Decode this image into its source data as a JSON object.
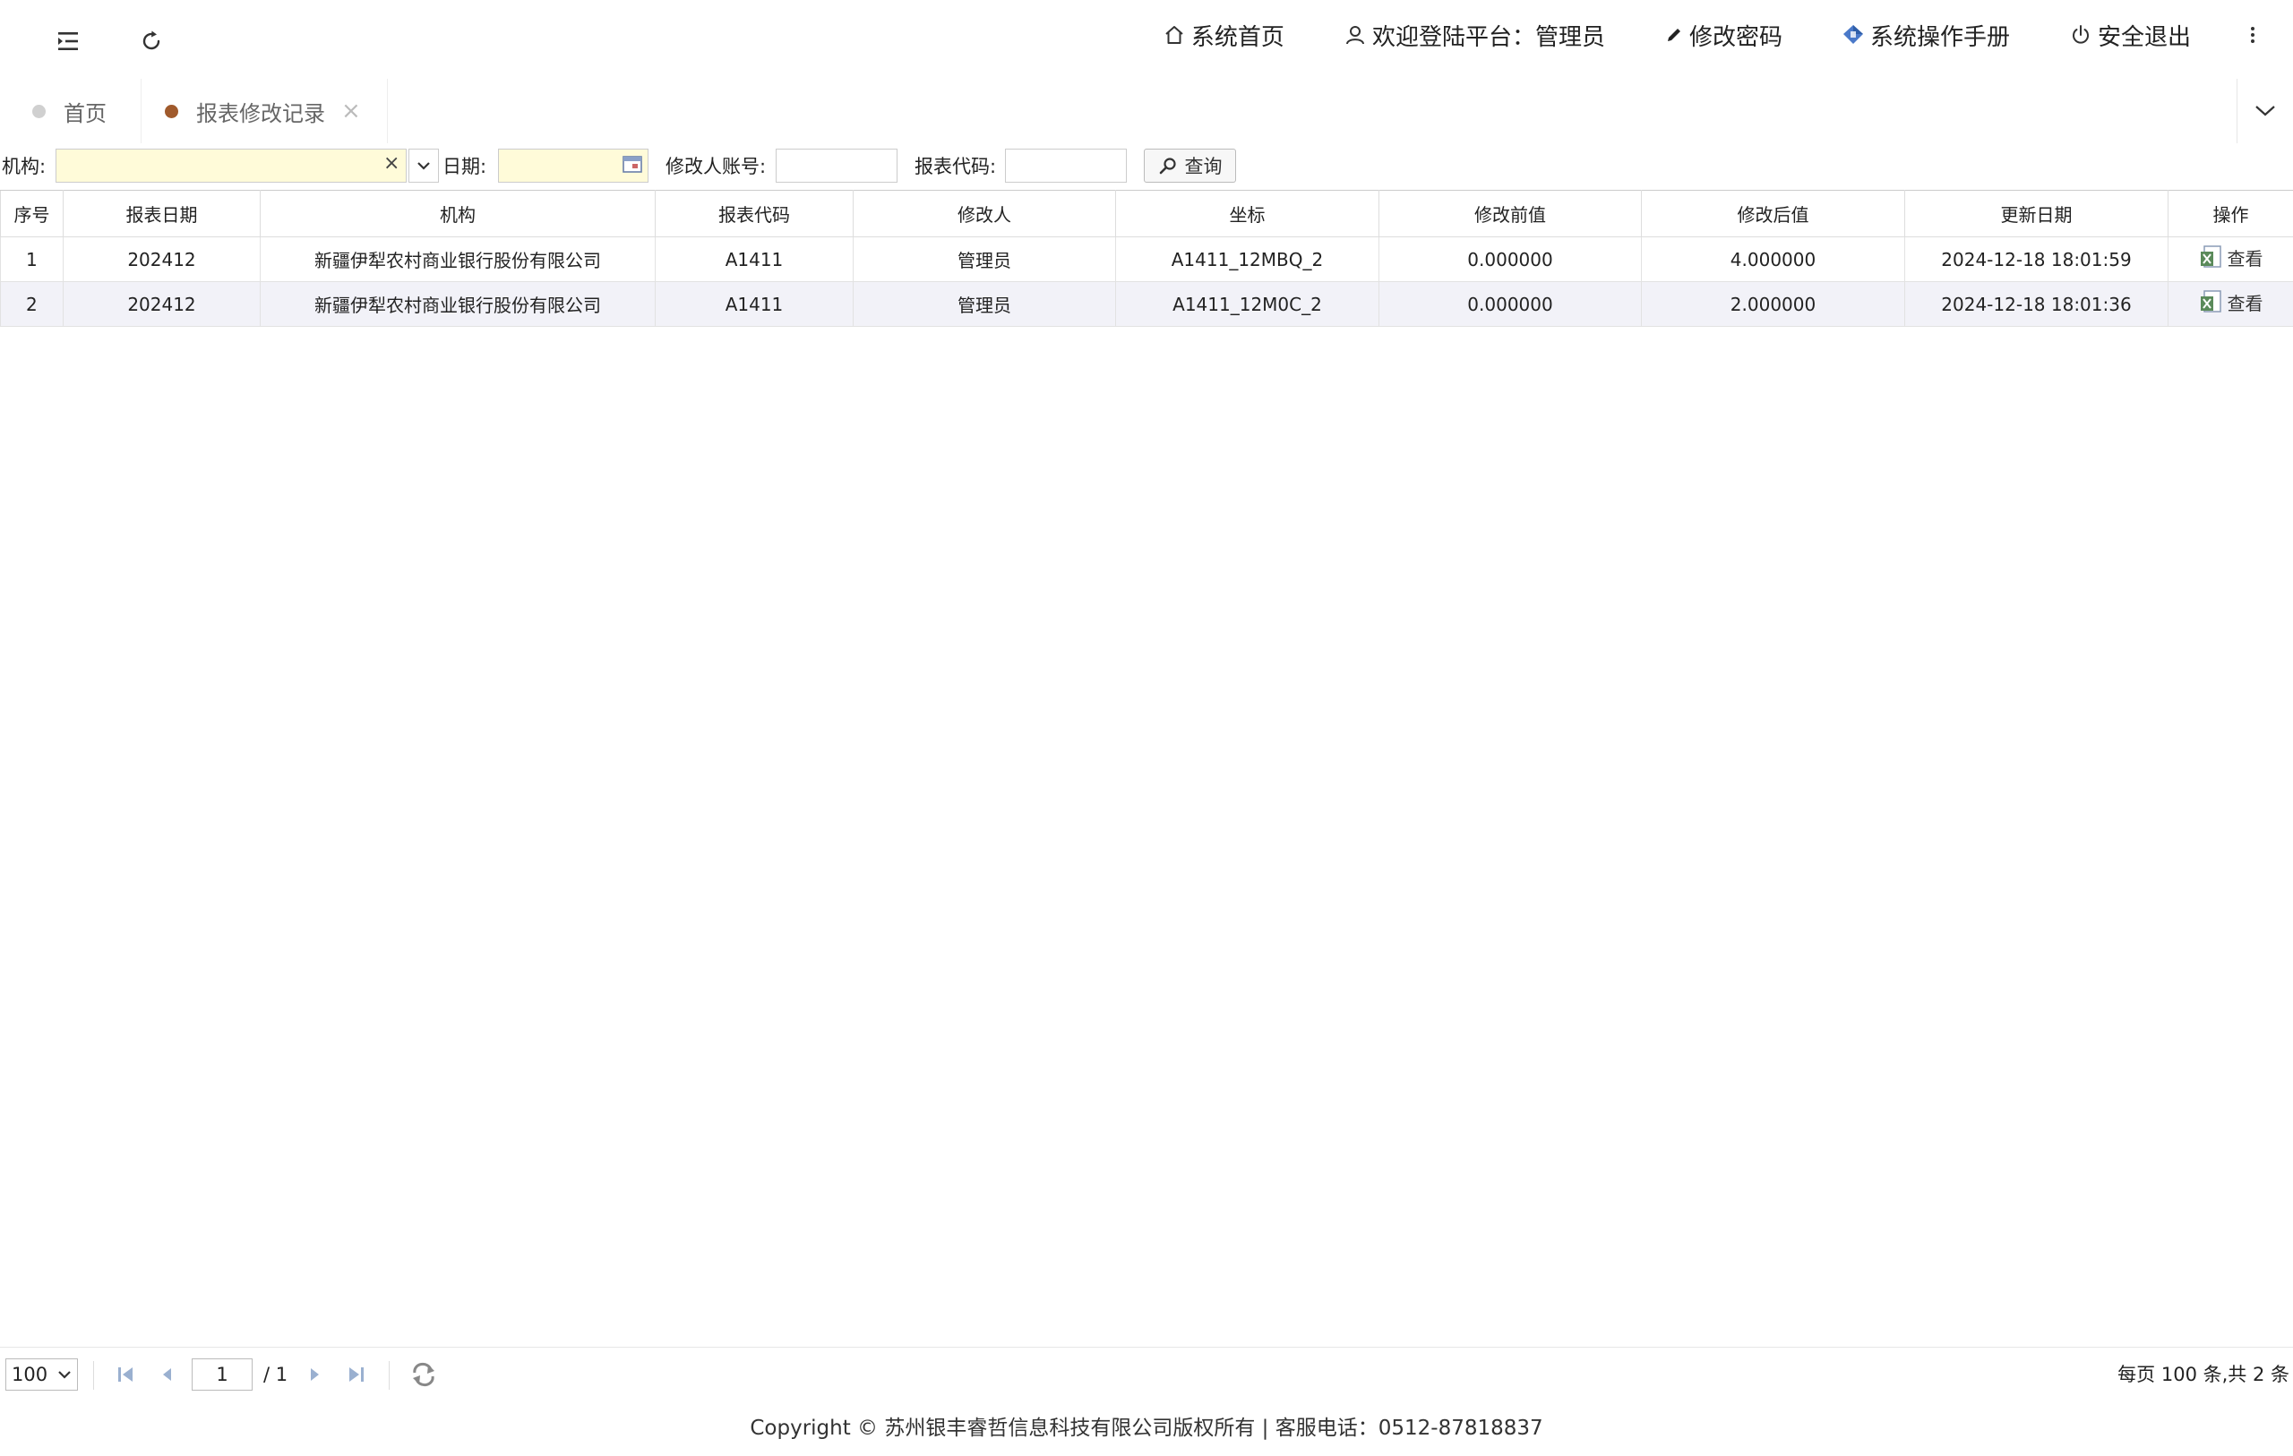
{
  "header": {
    "nav": [
      {
        "label": "系统首页",
        "icon": "home-icon"
      },
      {
        "label": "欢迎登陆平台：管理员",
        "icon": "user-icon"
      },
      {
        "label": "修改密码",
        "icon": "pencil-icon"
      },
      {
        "label": "系统操作手册",
        "icon": "manual-book-icon"
      },
      {
        "label": "安全退出",
        "icon": "power-icon"
      }
    ]
  },
  "tabs": [
    {
      "label": "首页",
      "dot_color": "#d0d0d0",
      "active": false
    },
    {
      "label": "报表修改记录",
      "dot_color": "#a05a2c",
      "active": true,
      "close": "×"
    }
  ],
  "filter": {
    "org_label": "机构:",
    "org_value": "",
    "clear_symbol": "×",
    "date_label": "日期:",
    "date_value": "",
    "modifier_label": "修改人账号:",
    "modifier_value": "",
    "code_label": "报表代码:",
    "code_value": "",
    "query_label": "查询"
  },
  "table": {
    "columns": [
      "序号",
      "报表日期",
      "机构",
      "报表代码",
      "修改人",
      "坐标",
      "修改前值",
      "修改后值",
      "更新日期",
      "操作"
    ],
    "rows": [
      {
        "idx": "1",
        "report_date": "202412",
        "org": "新疆伊犁农村商业银行股份有限公司",
        "code": "A1411",
        "modifier": "管理员",
        "coord": "A1411_12MBQ_2",
        "before": "0.000000",
        "after": "4.000000",
        "updated": "2024-12-18 18:01:59",
        "action": "查看"
      },
      {
        "idx": "2",
        "report_date": "202412",
        "org": "新疆伊犁农村商业银行股份有限公司",
        "code": "A1411",
        "modifier": "管理员",
        "coord": "A1411_12M0C_2",
        "before": "0.000000",
        "after": "2.000000",
        "updated": "2024-12-18 18:01:36",
        "action": "查看"
      }
    ]
  },
  "pager": {
    "page_size": "100",
    "current_page": "1",
    "total_pages": "/ 1",
    "summary": "每页 100 条,共 2 条"
  },
  "footer": {
    "text": "Copyright © 苏州银丰睿哲信息科技有限公司版权所有 | 客服电话：0512-87818837"
  }
}
